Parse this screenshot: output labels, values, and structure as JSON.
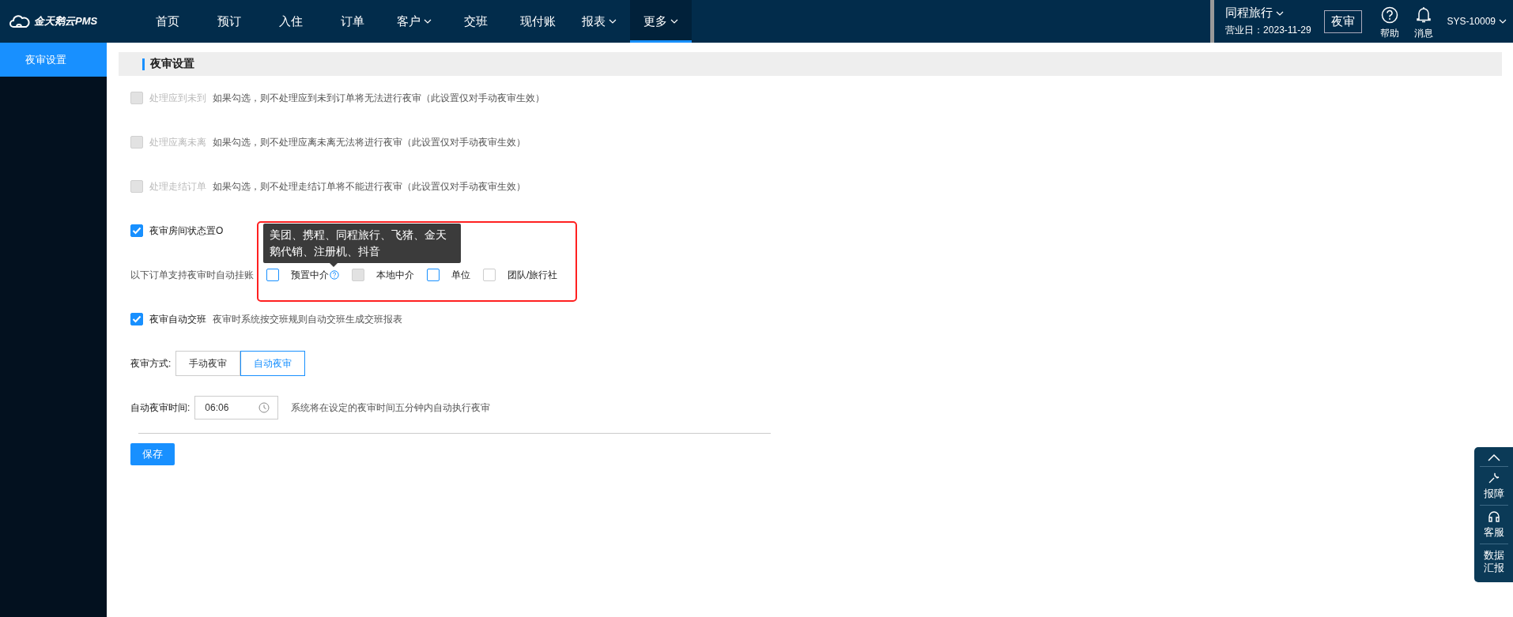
{
  "header": {
    "logo": "金天鹅云PMS",
    "nav": [
      {
        "label": "首页",
        "selected": false,
        "dropdown": false
      },
      {
        "label": "预订",
        "selected": false,
        "dropdown": false
      },
      {
        "label": "入住",
        "selected": false,
        "dropdown": false
      },
      {
        "label": "订单",
        "selected": false,
        "dropdown": false
      },
      {
        "label": "客户",
        "selected": false,
        "dropdown": true
      },
      {
        "label": "交班",
        "selected": false,
        "dropdown": false
      },
      {
        "label": "现付账",
        "selected": false,
        "dropdown": false
      },
      {
        "label": "报表",
        "selected": false,
        "dropdown": true
      },
      {
        "label": "更多",
        "selected": true,
        "dropdown": true
      }
    ],
    "hotel": "同程旅行",
    "business_date": "营业日：2023-11-29",
    "night_audit_button": "夜审",
    "help": "帮助",
    "messages": "消息",
    "user": "SYS-10009"
  },
  "sidebar": {
    "items": [
      {
        "label": "夜审设置",
        "selected": true
      }
    ]
  },
  "section_title": "夜审设置",
  "options": [
    {
      "label": "处理应到未到",
      "checked": false,
      "disabled": true,
      "description": "如果勾选，则不处理应到未到订单将无法进行夜审（此设置仅对手动夜审生效）"
    },
    {
      "label": "处理应离未离",
      "checked": false,
      "disabled": true,
      "description": "如果勾选，则不处理应离未离无法将进行夜审（此设置仅对手动夜审生效）"
    },
    {
      "label": "处理走结订单",
      "checked": false,
      "disabled": true,
      "description": "如果勾选，则不处理走结订单将不能进行夜审（此设置仅对手动夜审生效）"
    },
    {
      "label": "夜审房间状态置O",
      "checked": true,
      "disabled": false
    }
  ],
  "auto_post": {
    "label": "以下订单支持夜审时自动挂账",
    "items": [
      {
        "label": "预置中介",
        "checked": false,
        "disabled": false,
        "focused": true,
        "help": true
      },
      {
        "label": "本地中介",
        "checked": false,
        "disabled": true,
        "focused": false,
        "help": false
      },
      {
        "label": "单位",
        "checked": false,
        "disabled": false,
        "focused": true,
        "help": false
      },
      {
        "label": "团队/旅行社",
        "checked": false,
        "disabled": false,
        "focused": false,
        "help": false
      }
    ],
    "tooltip": "美团、携程、同程旅行、飞猪、金天鹅代销、注册机、抖音"
  },
  "auto_shift": {
    "label": "夜审自动交班",
    "checked": true,
    "description": "夜审时系统按交班规则自动交班生成交班报表"
  },
  "mode": {
    "label": "夜审方式:",
    "options": [
      {
        "label": "手动夜审",
        "selected": false
      },
      {
        "label": "自动夜审",
        "selected": true
      }
    ]
  },
  "time": {
    "label": "自动夜审时间:",
    "value": "06:06",
    "hint": "系统将在设定的夜审时间五分钟内自动执行夜审"
  },
  "save_button": "保存",
  "float_bar": {
    "items": [
      {
        "kind": "up"
      },
      {
        "kind": "wrench",
        "label": "报障"
      },
      {
        "kind": "headset",
        "label": "客服"
      },
      {
        "kind": "text",
        "label": "数据汇报"
      }
    ]
  }
}
